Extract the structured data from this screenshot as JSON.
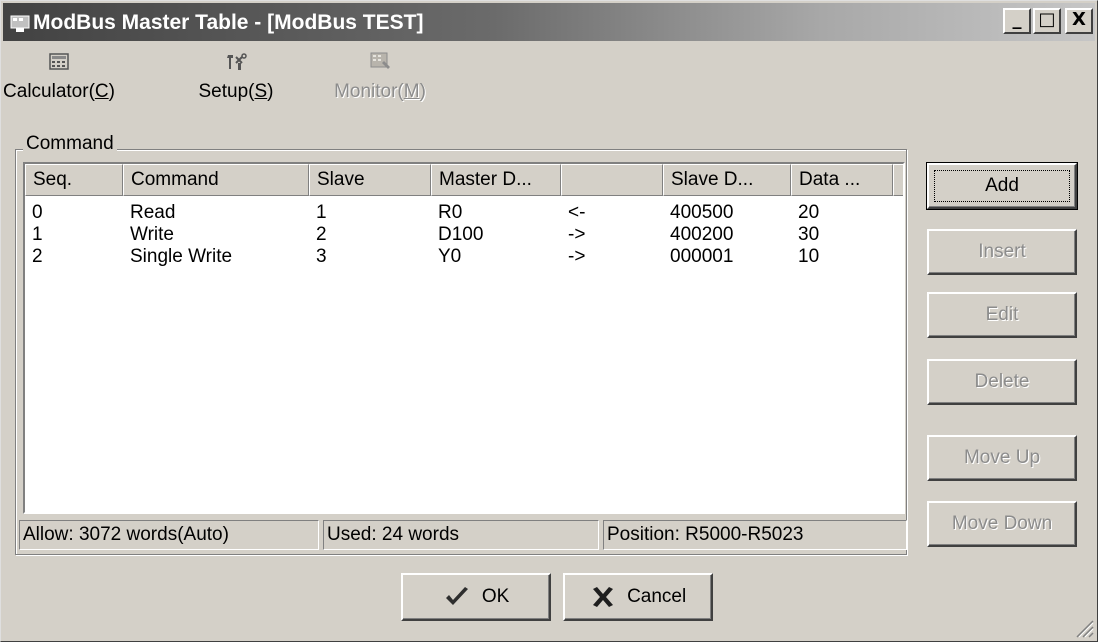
{
  "window": {
    "title": "ModBus Master Table - [ModBus TEST]",
    "controls": {
      "minimize": "_",
      "maximize": "□",
      "close": "X"
    }
  },
  "toolbar": {
    "calculator": {
      "label_main": "Calculator(",
      "label_key": "C",
      "label_end": ")",
      "icon": "calculator-icon"
    },
    "setup": {
      "label_main": "Setup(",
      "label_key": "S",
      "label_end": ")",
      "icon": "tools-icon"
    },
    "monitor": {
      "label_main": "Monitor(",
      "label_key": "M",
      "label_end": ")",
      "icon": "monitor-icon",
      "enabled": false
    }
  },
  "command_group": {
    "label": "Command",
    "columns": [
      "Seq.",
      "Command",
      "Slave",
      "Master D...",
      "",
      "Slave D...",
      "Data ..."
    ],
    "rows": [
      {
        "seq": "0",
        "command": "Read",
        "slave": "1",
        "master": "R0",
        "dir": "<-",
        "slave_dev": "400500",
        "data": "20"
      },
      {
        "seq": "1",
        "command": "Write",
        "slave": "2",
        "master": "D100",
        "dir": "->",
        "slave_dev": "400200",
        "data": "30"
      },
      {
        "seq": "2",
        "command": "Single Write",
        "slave": "3",
        "master": "Y0",
        "dir": "->",
        "slave_dev": "000001",
        "data": "10"
      }
    ]
  },
  "status": {
    "allow": "Allow: 3072 words(Auto)",
    "used": "Used: 24 words",
    "position": "Position: R5000-R5023"
  },
  "buttons": {
    "add": "Add",
    "insert": "Insert",
    "edit": "Edit",
    "delete": "Delete",
    "move_up": "Move Up",
    "move_down": "Move Down",
    "ok": "OK",
    "cancel": "Cancel"
  },
  "colors": {
    "face": "#d4d0c8",
    "title_dark": "#424242",
    "disabled_text": "#8c8c8c",
    "ok_check": "#2e2e2e"
  }
}
